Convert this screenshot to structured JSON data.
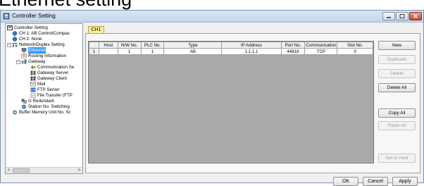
{
  "heading": {
    "text": "Ethernet setting"
  },
  "window": {
    "title": "Controller Setting"
  },
  "tree": {
    "nodes": [
      {
        "label": "Controller Setting",
        "icon": "controller-icon"
      },
      {
        "label": "CH 1: AB Control/Compac",
        "icon": "channel-icon"
      },
      {
        "label": "CH 2: None",
        "icon": "channel-icon"
      },
      {
        "label": "Network/Duplex Setting",
        "icon": "network-icon"
      },
      {
        "label": "Ethernet",
        "icon": "ethernet-icon",
        "selected": true
      },
      {
        "label": "Routing Information",
        "icon": "routing-icon"
      },
      {
        "label": "Gateway",
        "icon": "gateway-icon"
      },
      {
        "label": "Communication Se",
        "icon": "communication-icon"
      },
      {
        "label": "Gateway Server",
        "icon": "server-icon"
      },
      {
        "label": "Gateway Client",
        "icon": "client-icon"
      },
      {
        "label": "Mail",
        "icon": "mail-icon"
      },
      {
        "label": "FTP Server",
        "icon": "ftp-icon"
      },
      {
        "label": "File Transfer (FTP",
        "icon": "file-transfer-icon"
      },
      {
        "label": "G Redundant",
        "icon": "redundant-icon"
      },
      {
        "label": "Station No. Switching",
        "icon": "station-icon"
      },
      {
        "label": "Buffer Memory Unit No. Sc",
        "icon": "buffer-icon"
      }
    ],
    "scroll_left": "<",
    "scroll_right": ">"
  },
  "tab": {
    "label": "CH1"
  },
  "table": {
    "columns": [
      "",
      "Host",
      "N/W No.",
      "PLC No.",
      "Type",
      "IP Address",
      "Port No.",
      "Communication",
      "Slot No."
    ],
    "rows": [
      [
        "1",
        "",
        "1",
        "1",
        "AB",
        "1.1.1.1",
        "44818",
        "TCP",
        "0"
      ]
    ]
  },
  "side_buttons": {
    "new": "New",
    "duplicate": "Duplicate",
    "delete": "Delete",
    "delete_all": "Delete All",
    "copy_all": "Copy All",
    "paste_all": "Paste All",
    "set_to_host": "Set to Host"
  },
  "bottom_buttons": {
    "ok": "OK",
    "cancel": "Cancel",
    "apply": "Apply"
  },
  "colors": {
    "tab": "#ffee99",
    "selection": "#3399ff",
    "grid_empty": "#aaaaaa"
  }
}
